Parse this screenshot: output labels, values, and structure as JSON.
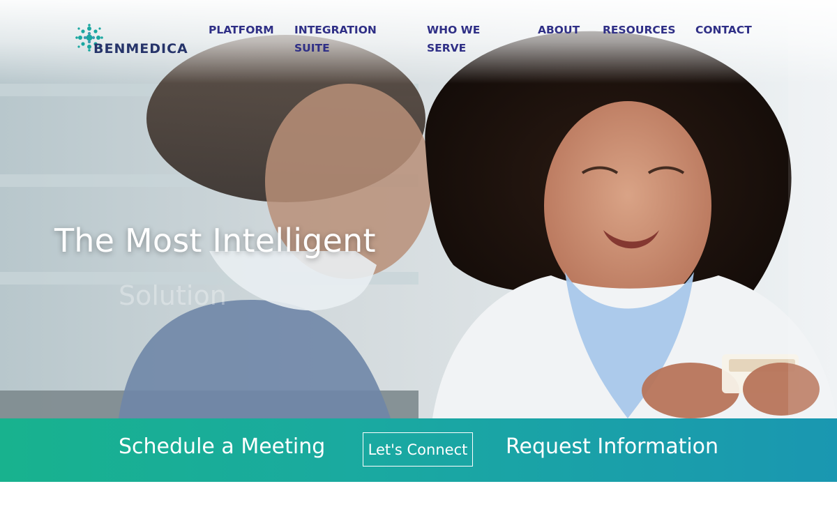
{
  "brand": {
    "name": "BENMEDICA"
  },
  "nav": {
    "items": [
      {
        "label": "PLATFORM"
      },
      {
        "label": "INTEGRATION SUITE"
      },
      {
        "label": "WHO WE SERVE"
      },
      {
        "label": "ABOUT"
      },
      {
        "label": "RESOURCES"
      },
      {
        "label": "CONTACT"
      }
    ]
  },
  "hero": {
    "title": "The Most Intelligent",
    "subtitle_ghost": "Solution"
  },
  "cta": {
    "left_label": "Schedule a Meeting",
    "button_label": "Let's Connect",
    "right_label": "Request Information"
  },
  "colors": {
    "nav_text": "#2f2f86",
    "brand_text": "#26346a",
    "cta_gradient_start": "#18b28e",
    "cta_gradient_end": "#1a97b1",
    "white": "#ffffff"
  }
}
